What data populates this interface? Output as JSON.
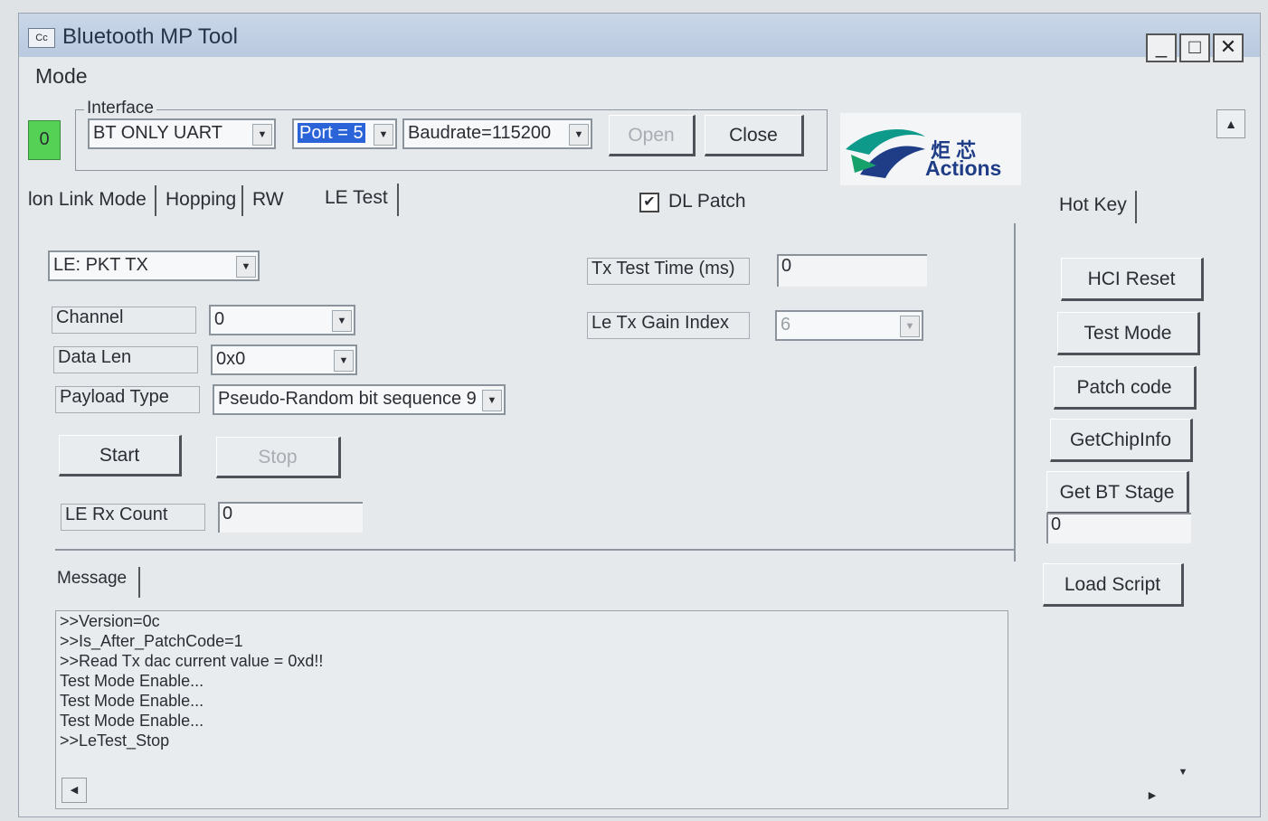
{
  "window": {
    "title": "Bluetooth MP Tool",
    "icon_text": "Cc",
    "minimize": "_",
    "maximize": "□",
    "close": "✕"
  },
  "menu": {
    "mode": "Mode"
  },
  "status_indicator": "0",
  "interface": {
    "group_label": "Interface",
    "type": "BT ONLY UART",
    "port": "Port = 5",
    "baudrate": "Baudrate=115200",
    "open_label": "Open",
    "close_label": "Close"
  },
  "logo": {
    "cn": "炬 芯",
    "en": "Actions"
  },
  "tabs": {
    "items": [
      "Non Link Mode",
      "Hopping",
      "RW",
      "LE Test"
    ],
    "visible_first": "lon Link Mode"
  },
  "dl_patch": {
    "label": "DL Patch",
    "checked": "✔"
  },
  "le_test": {
    "mode": "LE: PKT TX",
    "channel_label": "Channel",
    "channel_value": "0",
    "data_len_label": "Data Len",
    "data_len_value": "0x0",
    "payload_label": "Payload Type",
    "payload_value": "Pseudo-Random bit sequence 9",
    "start_label": "Start",
    "stop_label": "Stop",
    "rx_count_label": "LE Rx Count",
    "rx_count_value": "0",
    "tx_time_label": "Tx Test Time (ms)",
    "tx_time_value": "0",
    "gain_label": "Le Tx Gain Index",
    "gain_value": "6"
  },
  "hotkey": {
    "label": "Hot Key",
    "hci_reset": "HCI Reset",
    "test_mode": "Test Mode",
    "patch_code": "Patch code",
    "get_chip_info": "GetChipInfo",
    "get_bt_stage": "Get BT Stage",
    "stage_value": "0",
    "load_script": "Load Script"
  },
  "message": {
    "label": "Message",
    "lines": [
      ">>Version=0c",
      ">>Is_After_PatchCode=1",
      ">>Read Tx dac current value = 0xd!!",
      "Test Mode Enable...",
      "Test Mode Enable...",
      "Test Mode Enable...",
      ">>LeTest_Stop"
    ]
  },
  "arrows": {
    "down": "▼",
    "up": "▲",
    "left": "◀",
    "right": "▶"
  }
}
